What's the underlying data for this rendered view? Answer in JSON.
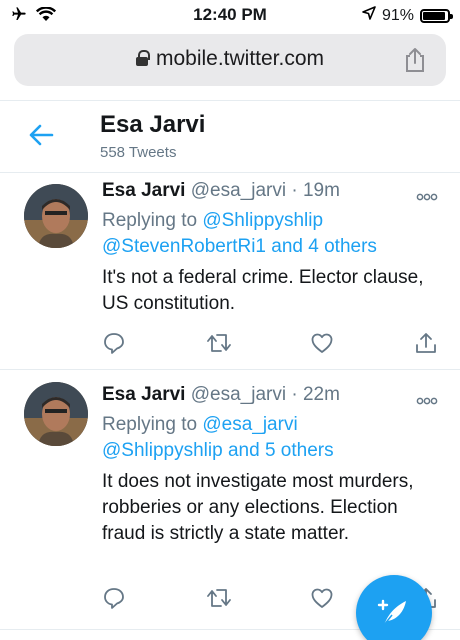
{
  "status": {
    "time": "12:40 PM",
    "battery": "91%",
    "battery_level": 0.91
  },
  "browser": {
    "url": "mobile.twitter.com"
  },
  "profile": {
    "name": "Esa Jarvi",
    "tweet_count": "558 Tweets"
  },
  "tweets": [
    {
      "name": "Esa Jarvi",
      "handle": "@esa_jarvi",
      "sep": "·",
      "time": "19m",
      "reply_prefix": "Replying to",
      "reply_user1": "@Shlippyshlip",
      "reply_user2": "@StevenRobertRi1",
      "reply_and": "and",
      "reply_others": "4 others",
      "text": "It's not a federal crime. Elector clause, US constitution."
    },
    {
      "name": "Esa Jarvi",
      "handle": "@esa_jarvi",
      "sep": "·",
      "time": "22m",
      "reply_prefix": "Replying to",
      "reply_user1": "@esa_jarvi",
      "reply_user2": "@Shlippyshlip",
      "reply_and": "and",
      "reply_others": "5 others",
      "text": "It does not investigate most murders, robberies or any elections. Election fraud is strictly a state matter."
    }
  ],
  "colors": {
    "accent": "#1da1f2",
    "secondary_text": "#657786",
    "divider": "#e6ecf0",
    "urlbar": "#e9e9eb"
  },
  "icons": [
    "airplane-icon",
    "wifi-icon",
    "location-arrow-icon",
    "battery-icon",
    "lock-icon",
    "share-icon",
    "back-arrow-icon",
    "more-icon",
    "reply-icon",
    "retweet-icon",
    "like-icon",
    "compose-icon"
  ]
}
